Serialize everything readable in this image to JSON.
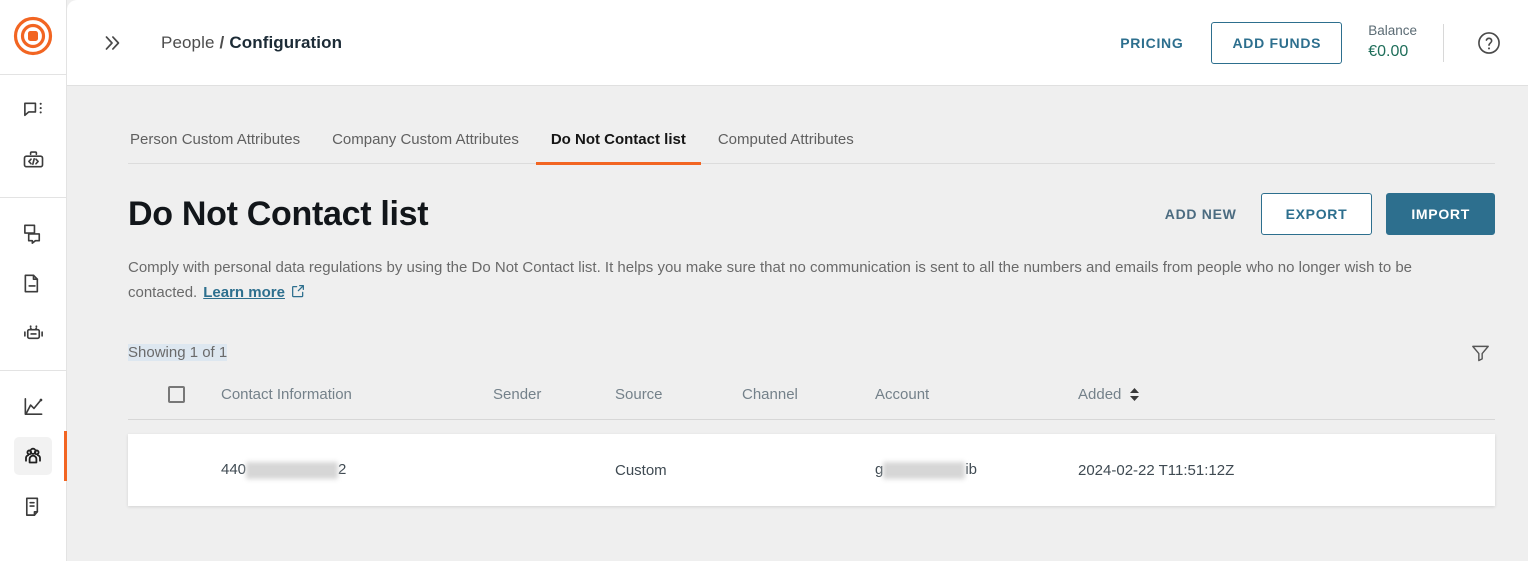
{
  "app": {
    "logo_icon": "bullseye-logo-icon",
    "accent_orange": "#f26522",
    "accent_blue": "#2d6f8e"
  },
  "rail": {
    "groups": [
      {
        "items": [
          {
            "icon": "chat-bubble-menu-icon",
            "name": "conversations",
            "selected": false
          },
          {
            "icon": "code-briefcase-icon",
            "name": "developer-tools",
            "selected": false
          }
        ]
      },
      {
        "items": [
          {
            "icon": "multi-chat-icon",
            "name": "campaigns",
            "selected": false
          },
          {
            "icon": "inbox-archive-icon",
            "name": "templates",
            "selected": false
          },
          {
            "icon": "robot-icon",
            "name": "bots",
            "selected": false
          }
        ]
      },
      {
        "items": [
          {
            "icon": "line-chart-icon",
            "name": "analytics",
            "selected": false
          },
          {
            "icon": "people-group-icon",
            "name": "people",
            "selected": true
          },
          {
            "icon": "document-book-icon",
            "name": "logs",
            "selected": false
          }
        ]
      }
    ]
  },
  "topbar": {
    "expand_icon": "double-chevron-right-icon",
    "breadcrumb": {
      "parent": "People",
      "separator": "/",
      "current": "Configuration"
    },
    "pricing_label": "PRICING",
    "add_funds_label": "ADD FUNDS",
    "balance_label": "Balance",
    "balance_value": "€0.00",
    "help_icon": "question-circle-icon"
  },
  "tabs": [
    {
      "label": "Person Custom Attributes",
      "active": false
    },
    {
      "label": "Company Custom Attributes",
      "active": false
    },
    {
      "label": "Do Not Contact list",
      "active": true
    },
    {
      "label": "Computed Attributes",
      "active": false
    }
  ],
  "page": {
    "title": "Do Not Contact list",
    "add_new_label": "ADD NEW",
    "export_label": "EXPORT",
    "import_label": "IMPORT",
    "description": "Comply with personal data regulations by using the Do Not Contact list. It helps you make sure that no communication is sent to all the numbers and emails from people who no longer wish to be contacted.",
    "learn_more_label": "Learn more",
    "external_link_icon": "external-link-icon",
    "showing_text": "Showing 1 of 1",
    "filter_icon": "funnel-filter-icon"
  },
  "table": {
    "columns": {
      "contact": "Contact Information",
      "sender": "Sender",
      "source": "Source",
      "channel": "Channel",
      "account": "Account",
      "added": "Added"
    },
    "sort_icon": "sort-updown-icon",
    "select_all_checkbox": "unchecked",
    "rows": [
      {
        "contact_prefix": "440",
        "contact_redacted": true,
        "contact_suffix": "2",
        "sender": "",
        "source": "Custom",
        "channel": "",
        "account_prefix": "g",
        "account_redacted": true,
        "account_suffix": "ib",
        "added": "2024-02-22 T11:51:12Z"
      }
    ]
  }
}
